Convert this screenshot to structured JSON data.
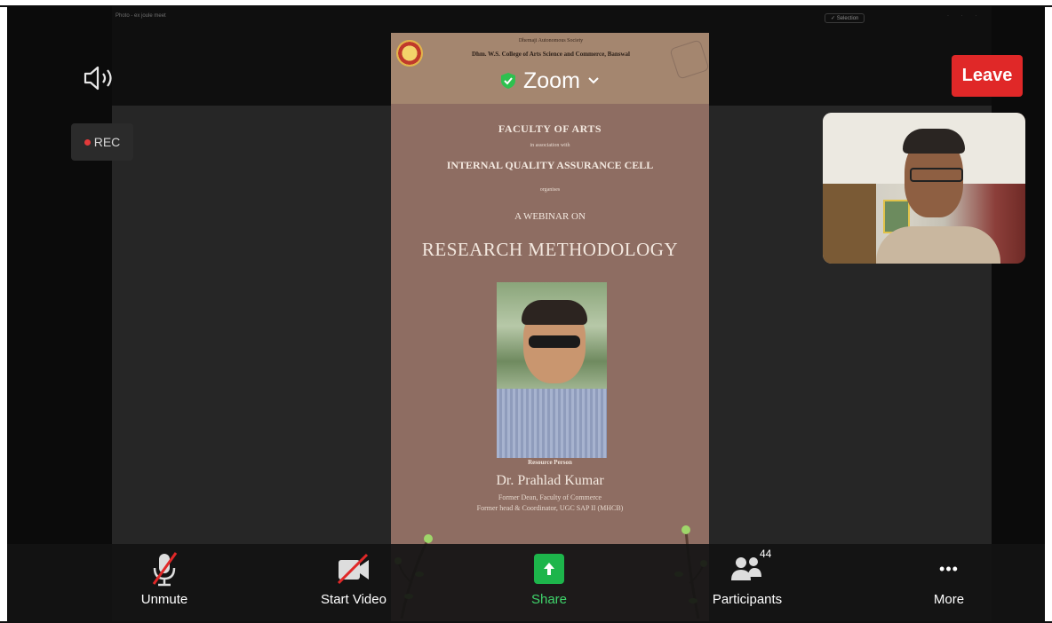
{
  "window": {
    "small_title": "Photo - ex joule meet",
    "small_right_label": "✓ Selection"
  },
  "topbar": {
    "app_name": "Zoom",
    "leave_label": "Leave",
    "rec_label": "REC",
    "colors": {
      "leave": "#e02828",
      "shield": "#2ec04f",
      "rec_dot": "#e23a3a"
    }
  },
  "poster": {
    "institution_line1": "Dhemaji Autonomous Society",
    "institution_line2": "Dhm. W.S. College of Arts Science and Commerce, Banswal",
    "faculty": "FACULTY OF ARTS",
    "in_collaboration": "in association with",
    "iqac": "INTERNAL QUALITY ASSURANCE CELL",
    "organises": "organises",
    "webinar": "A WEBINAR ON",
    "topic": "RESEARCH METHODOLOGY",
    "resource_label": "Resource Person",
    "speaker_name": "Dr. Prahlad Kumar",
    "designation1": "Former Dean, Faculty of Commerce",
    "designation2": "Former head & Coordinator, UGC SAP II (MHCB)"
  },
  "toolbar": {
    "unmute": "Unmute",
    "start_video": "Start Video",
    "share": "Share",
    "participants": "Participants",
    "participant_count": "44",
    "more": "More",
    "more_icon": "•••"
  }
}
